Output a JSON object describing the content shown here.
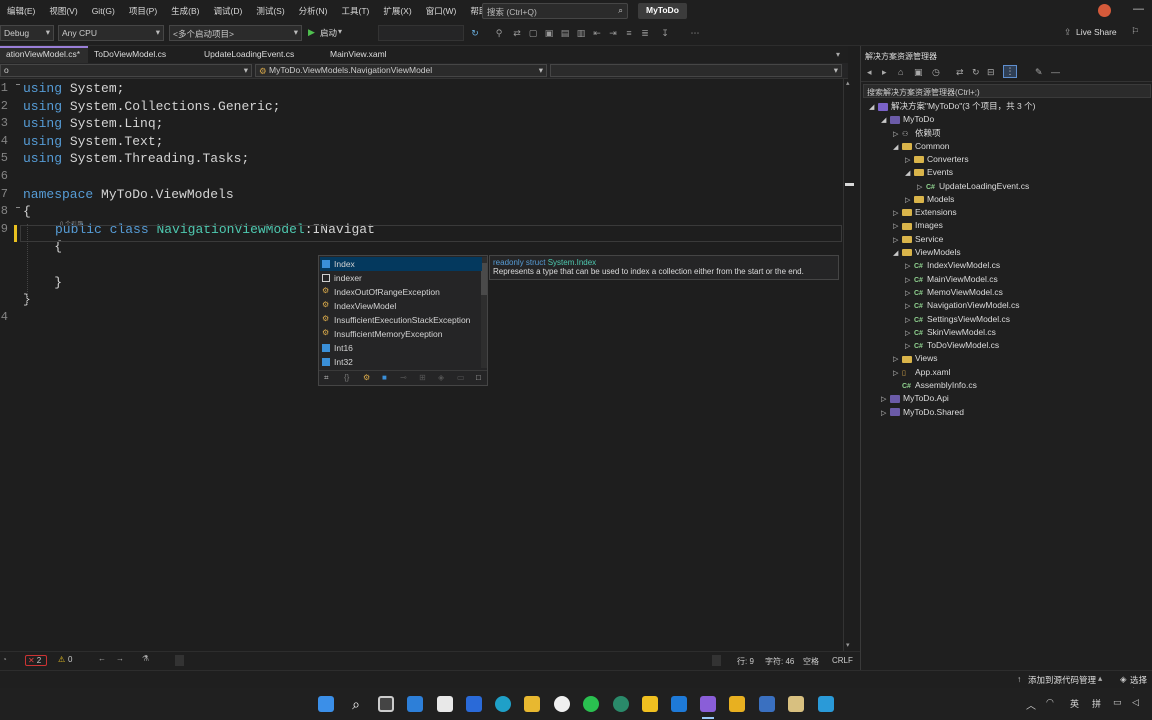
{
  "menu": [
    "编辑(E)",
    "视图(V)",
    "Git(G)",
    "项目(P)",
    "生成(B)",
    "调试(D)",
    "测试(S)",
    "分析(N)",
    "工具(T)",
    "扩展(X)",
    "窗口(W)",
    "帮助(H)"
  ],
  "search": {
    "placeholder": "搜索 (Ctrl+Q)"
  },
  "solution_name": "MyToDo",
  "live_share": "Live Share",
  "toolbar": {
    "config": "Debug",
    "platform": "Any CPU",
    "startup": "<多个启动项目>",
    "start": "启动"
  },
  "tabs": [
    {
      "label": "ationViewModel.cs*",
      "active": true
    },
    {
      "label": "ToDoViewModel.cs",
      "active": false
    },
    {
      "label": "UpdateLoadingEvent.cs",
      "active": false
    },
    {
      "label": "MainView.xaml",
      "active": false
    }
  ],
  "navbar": {
    "left": "o",
    "middle": "MyToDo.ViewModels.NavigationViewModel"
  },
  "code": {
    "lines": [
      {
        "n": "1",
        "kw": "using",
        "rest": " System;"
      },
      {
        "n": "2",
        "kw": "using",
        "rest": " System.Collections.Generic;"
      },
      {
        "n": "3",
        "kw": "using",
        "rest": " System.Linq;"
      },
      {
        "n": "4",
        "kw": "using",
        "rest": " System.Text;"
      },
      {
        "n": "5",
        "kw": "using",
        "rest": " System.Threading.Tasks;"
      },
      {
        "n": "6",
        "kw": "",
        "rest": ""
      },
      {
        "n": "7",
        "kw": "namespace",
        "rest": " MyToDo.ViewModels"
      },
      {
        "n": "8",
        "kw": "",
        "rest": "{"
      },
      {
        "n": "9",
        "kw": "",
        "rest": ""
      },
      {
        "n": "",
        "kw": "",
        "rest": "    {"
      },
      {
        "n": "",
        "kw": "",
        "rest": ""
      },
      {
        "n": "",
        "kw": "",
        "rest": "    }"
      },
      {
        "n": "",
        "kw": "",
        "rest": "}"
      },
      {
        "n": "4",
        "kw": "",
        "rest": ""
      }
    ],
    "codelens": "0 个引用",
    "class_line": {
      "kw1": "public",
      "kw2": "class",
      "name": "NavigationViewModel",
      "colon": ":",
      "typed": "INavigat"
    }
  },
  "completion": {
    "items": [
      {
        "label": "Index",
        "icon": "struct",
        "color": "#3a8fd8"
      },
      {
        "label": "indexer",
        "icon": "snippet",
        "color": "#cfcfcf"
      },
      {
        "label": "IndexOutOfRangeException",
        "icon": "class",
        "color": "#d8a84a"
      },
      {
        "label": "IndexViewModel",
        "icon": "class",
        "color": "#d8a84a"
      },
      {
        "label": "InsufficientExecutionStackException",
        "icon": "class",
        "color": "#d8a84a"
      },
      {
        "label": "InsufficientMemoryException",
        "icon": "class",
        "color": "#d8a84a"
      },
      {
        "label": "Int16",
        "icon": "struct",
        "color": "#3a8fd8"
      },
      {
        "label": "Int32",
        "icon": "struct",
        "color": "#3a8fd8"
      }
    ],
    "selected": 0
  },
  "tooltip": {
    "kind": "readonly struct",
    "name": "System.Index",
    "desc": "Represents a type that can be used to index a collection either from the start or the end."
  },
  "status": {
    "errors": "2",
    "warnings": "0",
    "line": "行: 9",
    "col": "字符: 46",
    "tab": "空格",
    "eol": "CRLF"
  },
  "solution_panel": {
    "title": "解决方案资源管理器",
    "search": "搜索解决方案资源管理器(Ctrl+;)",
    "root": "解决方案\"MyToDo\"(3 个项目，共 3 个)",
    "tree": [
      {
        "label": "MyToDo",
        "type": "project",
        "level": 1,
        "exp": "◢"
      },
      {
        "label": "依赖项",
        "type": "deps",
        "level": 2,
        "exp": "▷"
      },
      {
        "label": "Common",
        "type": "folder",
        "level": 2,
        "exp": "◢"
      },
      {
        "label": "Converters",
        "type": "folder",
        "level": 3,
        "exp": "▷"
      },
      {
        "label": "Events",
        "type": "folder",
        "level": 3,
        "exp": "◢"
      },
      {
        "label": "UpdateLoadingEvent.cs",
        "type": "cs",
        "level": 4,
        "exp": "▷"
      },
      {
        "label": "Models",
        "type": "folder",
        "level": 3,
        "exp": "▷"
      },
      {
        "label": "Extensions",
        "type": "folder",
        "level": 2,
        "exp": "▷"
      },
      {
        "label": "Images",
        "type": "folder",
        "level": 2,
        "exp": "▷"
      },
      {
        "label": "Service",
        "type": "folder",
        "level": 2,
        "exp": "▷"
      },
      {
        "label": "ViewModels",
        "type": "folder",
        "level": 2,
        "exp": "◢"
      },
      {
        "label": "IndexViewModel.cs",
        "type": "cs",
        "level": 3,
        "exp": "▷"
      },
      {
        "label": "MainViewModel.cs",
        "type": "cs",
        "level": 3,
        "exp": "▷"
      },
      {
        "label": "MemoViewModel.cs",
        "type": "cs",
        "level": 3,
        "exp": "▷"
      },
      {
        "label": "NavigationViewModel.cs",
        "type": "cs",
        "level": 3,
        "exp": "▷"
      },
      {
        "label": "SettingsViewModel.cs",
        "type": "cs",
        "level": 3,
        "exp": "▷"
      },
      {
        "label": "SkinViewModel.cs",
        "type": "cs",
        "level": 3,
        "exp": "▷"
      },
      {
        "label": "ToDoViewModel.cs",
        "type": "cs",
        "level": 3,
        "exp": "▷"
      },
      {
        "label": "Views",
        "type": "folder",
        "level": 2,
        "exp": "▷"
      },
      {
        "label": "App.xaml",
        "type": "xaml",
        "level": 2,
        "exp": "▷"
      },
      {
        "label": "AssemblyInfo.cs",
        "type": "cs",
        "level": 2,
        "exp": ""
      },
      {
        "label": "MyToDo.Api",
        "type": "project",
        "level": 1,
        "exp": "▷"
      },
      {
        "label": "MyToDo.Shared",
        "type": "project",
        "level": 1,
        "exp": "▷"
      }
    ]
  },
  "bottom": {
    "source_control": "添加到源代码管理",
    "repo": "选择存"
  },
  "taskbar": {
    "ime1": "英",
    "ime2": "拼"
  },
  "colors": {
    "accent": "#9a7fd8",
    "keyword": "#569cd6",
    "type": "#4ec9b0",
    "selection": "#04395e"
  }
}
